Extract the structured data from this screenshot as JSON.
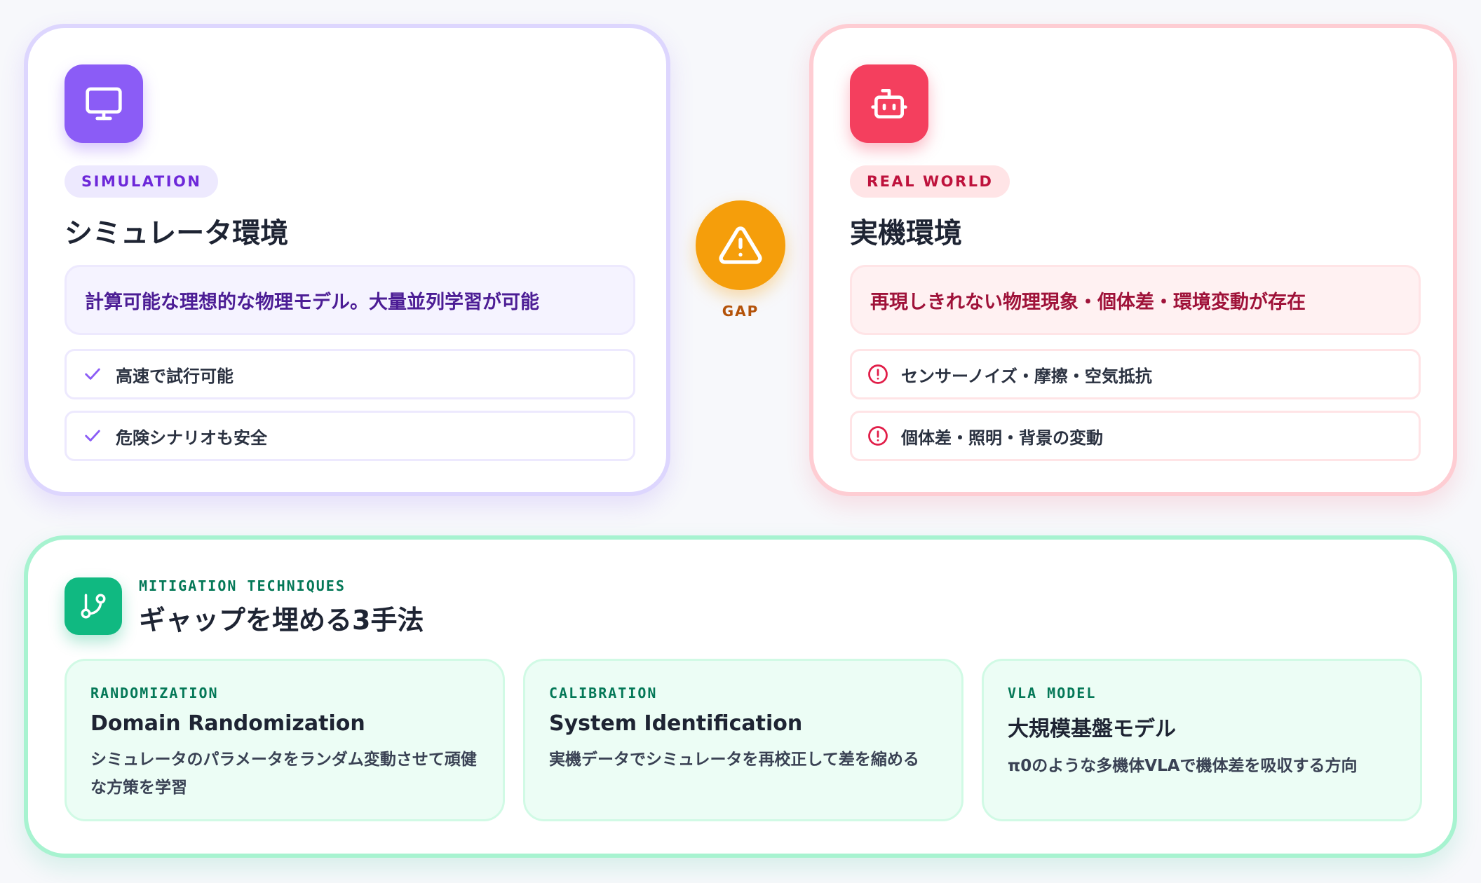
{
  "simulation": {
    "icon": "monitor-icon",
    "tag": "SIMULATION",
    "title": "シミュレータ環境",
    "description": "計算可能な理想的な物理モデル。大量並列学習が可能",
    "items": [
      {
        "icon": "check-icon",
        "text": "高速で試行可能"
      },
      {
        "icon": "check-icon",
        "text": "危険シナリオも安全"
      }
    ],
    "accent": "#8b5cf6"
  },
  "gap": {
    "icon": "warning-triangle-icon",
    "label": "GAP",
    "color": "#f59e0b"
  },
  "real_world": {
    "icon": "robot-icon",
    "tag": "REAL WORLD",
    "title": "実機環境",
    "description": "再現しきれない物理現象・個体差・環境変動が存在",
    "items": [
      {
        "icon": "alert-circle-icon",
        "text": "センサーノイズ・摩擦・空気抵抗"
      },
      {
        "icon": "alert-circle-icon",
        "text": "個体差・照明・背景の変動"
      }
    ],
    "accent": "#f43f5e"
  },
  "mitigation": {
    "icon": "git-branch-icon",
    "eyebrow": "MITIGATION TECHNIQUES",
    "title": "ギャップを埋める3手法",
    "accent": "#10b981",
    "techniques": [
      {
        "tag": "RANDOMIZATION",
        "title": "Domain Randomization",
        "description": "シミュレータのパラメータをランダム変動させて頑健な方策を学習"
      },
      {
        "tag": "CALIBRATION",
        "title": "System Identification",
        "description": "実機データでシミュレータを再校正して差を縮める"
      },
      {
        "tag": "VLA MODEL",
        "title": "大規模基盤モデル",
        "description": "π0のような多機体VLAで機体差を吸収する方向"
      }
    ]
  }
}
